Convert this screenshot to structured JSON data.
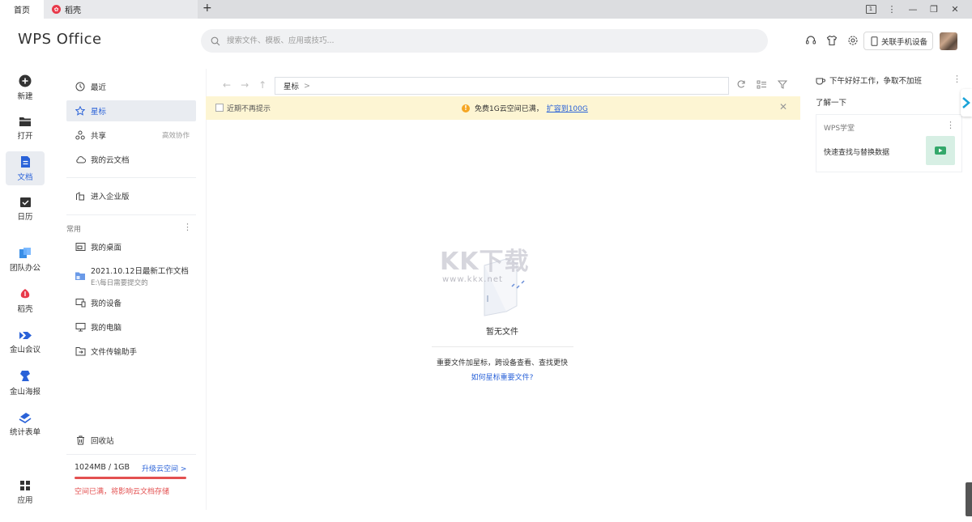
{
  "titlebar": {
    "tab_home": "首页",
    "tab_daoke": "稻壳",
    "page_indicator": "1"
  },
  "header": {
    "logo": "WPS Office",
    "search_placeholder": "搜索文件、模板、应用或技巧...",
    "link_phone": "关联手机设备"
  },
  "rail": {
    "items": [
      {
        "label": "新建"
      },
      {
        "label": "打开"
      },
      {
        "label": "文档"
      },
      {
        "label": "日历"
      },
      {
        "label": "团队办公"
      },
      {
        "label": "稻壳"
      },
      {
        "label": "金山会议"
      },
      {
        "label": "金山海报"
      },
      {
        "label": "统计表单"
      },
      {
        "label": "应用"
      }
    ],
    "active_index": 2
  },
  "sidebar": {
    "recent": "最近",
    "starred": "星标",
    "shared": "共享",
    "shared_extra": "高效协作",
    "cloud": "我的云文档",
    "enterprise": "进入企业版",
    "common_label": "常用",
    "desktop": "我的桌面",
    "folder_title": "2021.10.12日最新工作文档",
    "folder_path": "E:\\每日需要提交的",
    "devices": "我的设备",
    "computer": "我的电脑",
    "transfer": "文件传输助手",
    "recycle": "回收站",
    "storage_usage": "1024MB / 1GB",
    "storage_upgrade": "升级云空间 >",
    "storage_fill": 1.0,
    "storage_warning": "空间已满，将影响云文档存储"
  },
  "main": {
    "path": "星标",
    "path_chevron": ">",
    "banner_noremind": "近期不再提示",
    "banner_msg": "免费1G云空间已满，",
    "banner_link": "扩容到100G",
    "empty_title": "暂无文件",
    "empty_desc": "重要文件加星标，跨设备查看、查找更快",
    "empty_link": "如何星标重要文件?"
  },
  "watermark": {
    "brand": "KK下载",
    "url": "www.kkx.net"
  },
  "right_panel": {
    "greeting": "下午好好工作，争取不加班",
    "learn": "了解一下",
    "card_header": "WPS学堂",
    "card_text": "快速查找与替换数据"
  },
  "colors": {
    "accent": "#2a62d8",
    "warning": "#e35050",
    "banner_bg": "#fdf5d3",
    "active_bg": "#e9ecf1"
  }
}
